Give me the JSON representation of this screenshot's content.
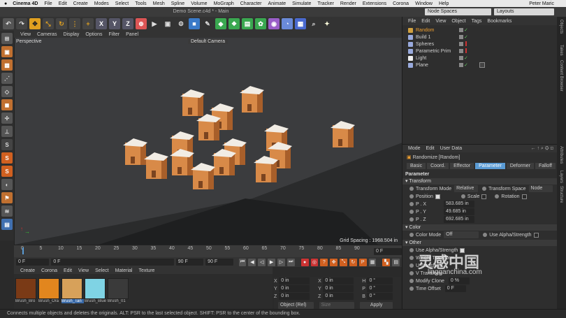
{
  "mac_menu": {
    "apple": "",
    "app": "Cinema 4D",
    "items": [
      "File",
      "Edit",
      "Create",
      "Modes",
      "Select",
      "Tools",
      "Mesh",
      "Spline",
      "Volume",
      "MoGraph",
      "Character",
      "Animate",
      "Simulate",
      "Tracker",
      "Render",
      "Extensions",
      "Corona",
      "Window",
      "Help"
    ],
    "user": "Peter Maric"
  },
  "window_title": "Demo Scene.c4d * - Main",
  "node_spaces": "Node Spaces",
  "layouts": "Layouts",
  "viewport_menu": [
    "View",
    "Cameras",
    "Display",
    "Options",
    "Filter",
    "Panel"
  ],
  "viewport": {
    "label": "Perspective",
    "camera": "Default Camera",
    "grid_spacing": "Grid Spacing : 1968.504 in"
  },
  "timeline": {
    "ticks": [
      "0",
      "5",
      "10",
      "15",
      "20",
      "25",
      "30",
      "35",
      "40",
      "45",
      "50",
      "55",
      "60",
      "65",
      "70",
      "75",
      "80",
      "85",
      "90"
    ],
    "frame_end": "0 F"
  },
  "transport": {
    "start": "0 F",
    "cur": "0 F",
    "end": "90 F",
    "max": "90 F"
  },
  "material_menu": [
    "Create",
    "Corona",
    "Edit",
    "View",
    "Select",
    "Material",
    "Texture"
  ],
  "materials": [
    {
      "name": "Brush_Bro",
      "color": "#7a3a16"
    },
    {
      "name": "Brush_Ora",
      "color": "#e2861e"
    },
    {
      "name": "Brush_Tan",
      "color": "#d7a15a"
    },
    {
      "name": "Brush_Blue",
      "color": "#7fd3e4"
    },
    {
      "name": "Brush_01",
      "color": "#3a3a3a"
    }
  ],
  "coords": {
    "rows": [
      {
        "a": "X",
        "av": "0 in",
        "b": "X",
        "bv": "0 in",
        "c": "H",
        "cv": "0 °"
      },
      {
        "a": "Y",
        "av": "0 in",
        "b": "Y",
        "bv": "0 in",
        "c": "P",
        "cv": "0 °"
      },
      {
        "a": "Z",
        "av": "0 in",
        "b": "Z",
        "bv": "0 in",
        "c": "B",
        "cv": "0 °"
      }
    ],
    "mode": "Object (Rel)",
    "size": "Size",
    "apply": "Apply"
  },
  "status": "Connects multiple objects and deletes the originals. ALT: PSR to the last selected object. SHIFT: PSR to the center of the bounding box.",
  "object_menu": [
    "File",
    "Edit",
    "View",
    "Object",
    "Tags",
    "Bookmarks"
  ],
  "objects": [
    {
      "name": "Random",
      "color": "#d0a040"
    },
    {
      "name": "Build 1",
      "color": "#9ad"
    },
    {
      "name": "Spheres",
      "color": "#9ad"
    },
    {
      "name": "Parametric Prim",
      "color": "#9ad"
    },
    {
      "name": "Light",
      "color": "#eee"
    },
    {
      "name": "Plane",
      "color": "#9ad"
    }
  ],
  "attr_menu": [
    "Mode",
    "Edit",
    "User Data"
  ],
  "attr_obj": "Randomize [Random]",
  "attr_tabs": [
    "Basic",
    "Coord.",
    "Effector",
    "Parameter",
    "Deformer",
    "Falloff"
  ],
  "attr_active": "Parameter",
  "attr": {
    "parameter": "Parameter",
    "transform": "Transform",
    "transform_mode": "Transform Mode",
    "tm_val": "Relative",
    "transform_space": "Transform Space",
    "ts_val": "Node",
    "position": "Position",
    "scale": "Scale",
    "rotation": "Rotation",
    "px": "P . X",
    "pxv": "583.685 in",
    "py": "P . Y",
    "pyv": "49.685 in",
    "pz": "P . Z",
    "pzv": "692.685 in",
    "color": "Color",
    "color_mode": "Color Mode",
    "cm_val": "Off",
    "use_alpha": "Use Alpha/Strength",
    "other": "Other",
    "use_alpha2": "Use Alpha/Strength",
    "weight": "Weight Transform",
    "u_t": "U Transform",
    "v_t": "V Transform",
    "modify_clone": "Modify Clone",
    "mc_val": "0 %",
    "time_offset": "Time Offset",
    "to_val": "0 F"
  },
  "side_tabs": [
    "Objects",
    "Takes",
    "Content Browser",
    "Attributes",
    "Layers",
    "Structure"
  ],
  "watermark": {
    "cn": "灵感中国",
    "url": "lingganchina.com"
  }
}
